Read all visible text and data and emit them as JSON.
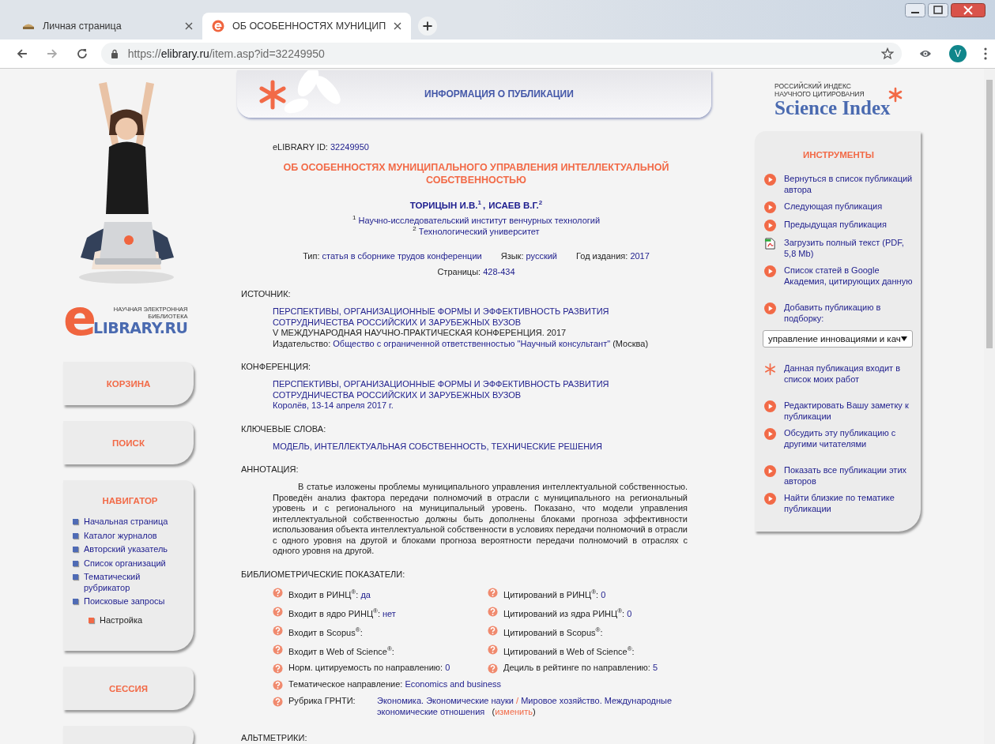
{
  "browser": {
    "tabs": [
      {
        "title": "Личная страница",
        "selected": false
      },
      {
        "title": "ОБ ОСОБЕННОСТЯХ МУНИЦИП",
        "selected": true
      }
    ],
    "url": {
      "scheme": "https://",
      "host": "elibrary.ru",
      "path": "/item.asp?id=32249950"
    },
    "profile": "V"
  },
  "left": {
    "logo": {
      "mark": "e",
      "tagline": [
        "НАУЧНАЯ ЭЛЕКТРОННАЯ",
        "БИБЛИОТЕКА"
      ],
      "name": "LIBRARY.RU"
    },
    "cards": [
      {
        "kind": "button",
        "label": "КОРЗИНА"
      },
      {
        "kind": "button",
        "label": "ПОИСК"
      },
      {
        "kind": "nav",
        "label": "НАВИГАТОР",
        "items": [
          {
            "kind": "main",
            "label": "Начальная страница"
          },
          {
            "kind": "main",
            "label": "Каталог журналов"
          },
          {
            "kind": "main",
            "label": "Авторский указатель"
          },
          {
            "kind": "main",
            "label": "Список организаций"
          },
          {
            "kind": "main",
            "label": "Тематический рубрикатор"
          },
          {
            "kind": "main",
            "label": "Поисковые запросы"
          },
          {
            "kind": "settings",
            "label": "Настройка"
          }
        ]
      },
      {
        "kind": "button",
        "label": "СЕССИЯ"
      },
      {
        "kind": "stub"
      }
    ]
  },
  "banner": {
    "title": "ИНФОРМАЦИЯ О ПУБЛИКАЦИИ"
  },
  "publication": {
    "id_label": "eLIBRARY ID:",
    "id": "32249950",
    "title": "ОБ ОСОБЕННОСТЯХ МУНИЦИПАЛЬНОГО УПРАВЛЕНИЯ ИНТЕЛЛЕКТУАЛЬНОЙ СОБСТВЕННОСТЬЮ",
    "authors": [
      {
        "name": "ТОРИЦЫН И.В.",
        "sup": "1"
      },
      {
        "name": "ИСАЕВ В.Г.",
        "sup": "2"
      }
    ],
    "author_separator": ",",
    "affiliations": [
      {
        "sup": "1",
        "name": "Научно-исследовательский институт венчурных технологий"
      },
      {
        "sup": "2",
        "name": "Технологический университет"
      }
    ],
    "meta": [
      {
        "label": "Тип:",
        "value": "статья в сборнике трудов конференции"
      },
      {
        "label": "Язык:",
        "value": "русский"
      },
      {
        "label": "Год издания:",
        "value": "2017"
      }
    ],
    "pages": {
      "label": "Страницы:",
      "value": "428-434"
    },
    "source": {
      "heading": "ИСТОЧНИК:",
      "title": "ПЕРСПЕКТИВЫ, ОРГАНИЗАЦИОННЫЕ ФОРМЫ И ЭФФЕКТИВНОСТЬ РАЗВИТИЯ СОТРУДНИЧЕСТВА РОССИЙСКИХ И ЗАРУБЕЖНЫХ ВУЗОВ",
      "conference": "V МЕЖДУНАРОДНАЯ НАУЧНО-ПРАКТИЧЕСКАЯ КОНФЕРЕНЦИЯ. 2017",
      "publisher_label": "Издательство:",
      "publisher": "Общество с ограниченной ответственностью \"Научный консультант\"",
      "city": "(Москва)"
    },
    "conference": {
      "heading": "КОНФЕРЕНЦИЯ:",
      "title": "ПЕРСПЕКТИВЫ, ОРГАНИЗАЦИОННЫЕ ФОРМЫ И ЭФФЕКТИВНОСТЬ РАЗВИТИЯ СОТРУДНИЧЕСТВА РОССИЙСКИХ И ЗАРУБЕЖНЫХ ВУЗОВ",
      "place": "Королёв, 13-14 апреля 2017 г."
    },
    "keywords": {
      "heading": "КЛЮЧЕВЫЕ СЛОВА:",
      "text": "МОДЕЛЬ, ИНТЕЛЛЕКТУАЛЬНАЯ СОБСТВЕННОСТЬ, ТЕХНИЧЕСКИЕ РЕШЕНИЯ"
    },
    "annotation": {
      "heading": "АННОТАЦИЯ:",
      "text": "В статье изложены проблемы муниципального управления интеллектуальной собственностью. Проведён анализ фактора передачи полномочий в отрасли с муниципального на региональный уровень и с регионального на муниципальный уровень. Показано, что модели управления интеллектуальной собственностью должны быть дополнены блоками прогноза эффективности использования объекта интеллектуальной собственности в условиях передачи полномочий в отрасли с одного уровня на другой и блоками прогноза вероятности передачи полномочий в отраслях с одного уровня на другой."
    },
    "metrics": {
      "heading": "БИБЛИОМЕТРИЧЕСКИЕ ПОКАЗАТЕЛИ:",
      "grid": [
        {
          "label": "Входит в РИНЦ$^{®}$:",
          "value": "да"
        },
        {
          "label": "Цитирований в РИНЦ$^{®}$:",
          "value": "0"
        },
        {
          "label": "Входит в ядро РИНЦ$^{®}$:",
          "value": "нет"
        },
        {
          "label": "Цитирований из ядра РИНЦ$^{®}$:",
          "value": "0"
        },
        {
          "label": "Входит в Scopus$^{®}$:"
        },
        {
          "label": "Цитирований в Scopus$^{®}$:"
        },
        {
          "label": "Входит в Web of Science$^{®}$:"
        },
        {
          "label": "Цитирований в Web of Science$^{®}$:"
        },
        {
          "label": "Норм. цитируемость по направлению:",
          "value": "0"
        },
        {
          "label": "Дециль в рейтинге по направлению:",
          "value": "5"
        }
      ],
      "topic": {
        "label": "Тематическое направление:",
        "value": "Economics and business"
      },
      "rubric": {
        "label": "Рубрика ГРНТИ:",
        "first": "Экономика. Экономические науки",
        "separator": "/",
        "second": "Мировое хозяйство. Международные экономические отношения",
        "open": "(",
        "change": "изменить",
        "close": ")"
      }
    },
    "altmetrics": {
      "heading": "АЛЬТМЕТРИКИ:"
    }
  },
  "right": {
    "logo": {
      "lines": [
        "РОССИЙСКИЙ ИНДЕКС",
        "НАУЧНОГО ЦИТИРОВАНИЯ"
      ],
      "name": "Science Index"
    },
    "tools": {
      "title": "ИНСТРУМЕНТЫ",
      "groups": [
        [
          {
            "kind": "link",
            "label": "Вернуться в список публикаций автора"
          },
          {
            "kind": "link",
            "label": "Следующая публикация"
          },
          {
            "kind": "link",
            "label": "Предыдущая публикация"
          },
          {
            "kind": "pdf",
            "label": "Загрузить полный текст (PDF, 5,8 Mb)"
          },
          {
            "kind": "link",
            "label": "Список статей в Google Академия, цитирующих данную"
          }
        ],
        [
          {
            "kind": "link",
            "label": "Добавить публикацию в подборку:"
          },
          {
            "kind": "select",
            "value": "управление инновациями и кач"
          }
        ],
        [
          {
            "kind": "mine",
            "label": "Данная публикация входит в список моих работ"
          }
        ],
        [
          {
            "kind": "link",
            "label": "Редактировать Вашу заметку к публикации"
          },
          {
            "kind": "link",
            "label": "Обсудить эту публикацию с другими читателями"
          }
        ],
        [
          {
            "kind": "link",
            "label": "Показать все публикации этих авторов"
          },
          {
            "kind": "link",
            "label": "Найти близкие по тематике публикации"
          }
        ]
      ]
    }
  }
}
